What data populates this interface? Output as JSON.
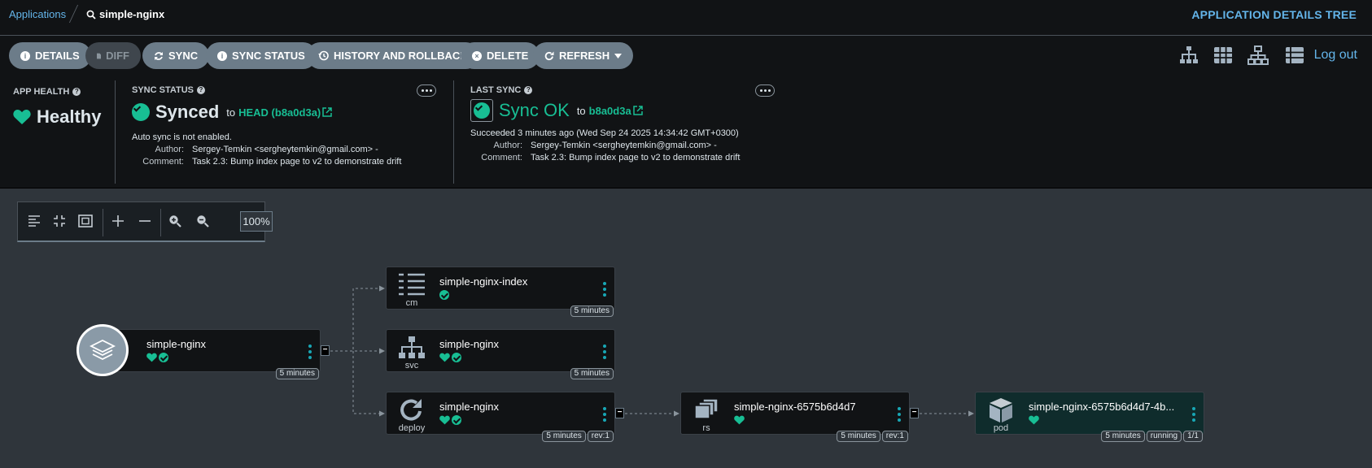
{
  "breadcrumb": {
    "root": "Applications",
    "current": "simple-nginx"
  },
  "view_title": "APPLICATION DETAILS TREE",
  "toolbar": {
    "details": "DETAILS",
    "diff": "DIFF",
    "sync": "SYNC",
    "sync_status": "SYNC STATUS",
    "history": "HISTORY AND ROLLBACK",
    "delete": "DELETE",
    "refresh": "REFRESH",
    "logout": "Log out"
  },
  "app_health": {
    "label": "APP HEALTH",
    "value": "Healthy"
  },
  "sync_status": {
    "label": "SYNC STATUS",
    "value": "Synced",
    "to": "to",
    "revision": "HEAD (b8a0d3a)",
    "auto_sync": "Auto sync is not enabled.",
    "author_label": "Author:",
    "author": "Sergey-Temkin <sergheytemkin@gmail.com> -",
    "comment_label": "Comment:",
    "comment": "Task 2.3: Bump index page to v2 to demonstrate drift"
  },
  "last_sync": {
    "label": "LAST SYNC",
    "value": "Sync OK",
    "to": "to",
    "revision": "b8a0d3a",
    "succeeded": "Succeeded 3 minutes ago (Wed Sep 24 2025 14:34:42 GMT+0300)",
    "author_label": "Author:",
    "author": "Sergey-Temkin <sergheytemkin@gmail.com> -",
    "comment_label": "Comment:",
    "comment": "Task 2.3: Bump index page to v2 to demonstrate drift"
  },
  "graph": {
    "zoom": "100%"
  },
  "nodes": {
    "app": {
      "name": "simple-nginx",
      "age": "5 minutes"
    },
    "cm": {
      "name": "simple-nginx-index",
      "kind": "cm",
      "age": "5 minutes"
    },
    "svc": {
      "name": "simple-nginx",
      "kind": "svc",
      "age": "5 minutes"
    },
    "deploy": {
      "name": "simple-nginx",
      "kind": "deploy",
      "age": "5 minutes",
      "rev": "rev:1"
    },
    "rs": {
      "name": "simple-nginx-6575b6d4d7",
      "kind": "rs",
      "age": "5 minutes",
      "rev": "rev:1"
    },
    "pod": {
      "name": "simple-nginx-6575b6d4d7-4b...",
      "kind": "pod",
      "age": "5 minutes",
      "state": "running",
      "ready": "1/1"
    }
  },
  "colors": {
    "healthy": "#18be94",
    "link": "#64b5ea",
    "button": "#6c7c89"
  }
}
